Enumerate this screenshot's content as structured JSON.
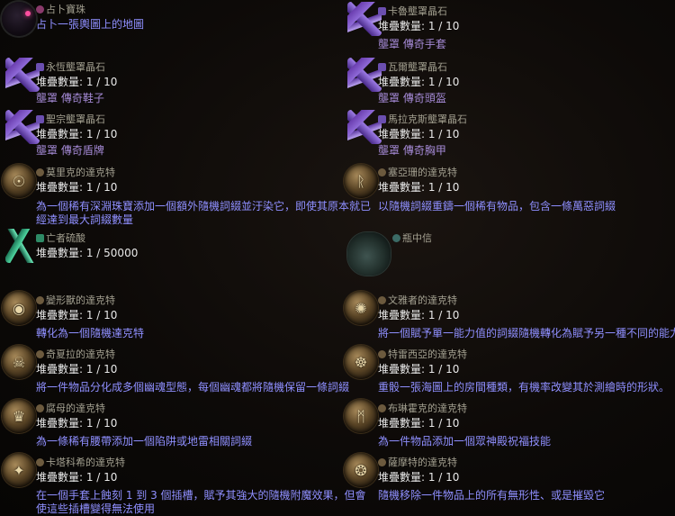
{
  "items": [
    {
      "name": "占卜寶珠",
      "stack": "",
      "desc": "占卜一張輿圖上的地圖",
      "veiled": "",
      "icon": "orb-icon"
    },
    {
      "name": "卡魯壟罩晶石",
      "stack": "堆疊數量: 1 / 10",
      "desc": "",
      "veiled": "壟罩 傳奇手套",
      "icon": "crystal-icon"
    },
    {
      "name": "永恆壟罩晶石",
      "stack": "堆疊數量: 1 / 10",
      "desc": "",
      "veiled": "壟罩 傳奇鞋子",
      "icon": "crystal-icon"
    },
    {
      "name": "瓦爾壟罩晶石",
      "stack": "堆疊數量: 1 / 10",
      "desc": "",
      "veiled": "壟罩 傳奇頭盔",
      "icon": "crystal-icon"
    },
    {
      "name": "聖宗壟罩晶石",
      "stack": "堆疊數量: 1 / 10",
      "desc": "",
      "veiled": "壟罩 傳奇盾牌",
      "icon": "crystal-icon"
    },
    {
      "name": "馬拉克斯壟罩晶石",
      "stack": "堆疊數量: 1 / 10",
      "desc": "",
      "veiled": "壟罩 傳奇胸甲",
      "icon": "crystal-icon"
    },
    {
      "name": "莫里克的達克特",
      "stack": "堆疊數量: 1 / 10",
      "desc": "為一個稀有深淵珠寶添加一個額外隨機詞綴並汙染它，即使其原本就已",
      "desc2": "經達到最大詞綴數量",
      "veiled": "",
      "icon": "ducat-icon"
    },
    {
      "name": "塞亞珊的達克特",
      "stack": "堆疊數量: 1 / 10",
      "desc": "以隨機詞綴重鑄一個稀有物品，包含一條萬惡詞綴",
      "veiled": "",
      "icon": "ducat-icon"
    },
    {
      "name": "亡者硫酸",
      "stack": "堆疊數量: 1 / 50000",
      "desc": "",
      "veiled": "",
      "icon": "acid-icon"
    },
    {
      "name": "瓶中信",
      "stack": "",
      "desc": "",
      "veiled": "",
      "icon": "bottle-icon"
    },
    {
      "name": "變形獸的達克特",
      "stack": "堆疊數量: 1 / 10",
      "desc": "轉化為一個隨機達克特",
      "veiled": "",
      "icon": "ducat-icon"
    },
    {
      "name": "文雅者的達克特",
      "stack": "堆疊數量: 1 / 10",
      "desc": "將一個賦予單一能力值的詞綴隨機轉化為賦予另一種不同的能力值",
      "veiled": "",
      "icon": "ducat-icon"
    },
    {
      "name": "奇夏拉的達克特",
      "stack": "堆疊數量: 1 / 10",
      "desc": "將一件物品分化成多個幽魂型態，每個幽魂都將隨機保留一條詞綴",
      "veiled": "",
      "icon": "ducat-icon"
    },
    {
      "name": "特雷西亞的達克特",
      "stack": "堆疊數量: 1 / 10",
      "desc": "重骰一張海圖上的房間種類，有機率改變其於測繪時的形狀。",
      "veiled": "",
      "icon": "ducat-icon"
    },
    {
      "name": "腐母的達克特",
      "stack": "堆疊數量: 1 / 10",
      "desc": "為一條稀有腰帶添加一個陷阱或地雷相關詞綴",
      "veiled": "",
      "icon": "ducat-icon"
    },
    {
      "name": "布琳霍克的達克特",
      "stack": "堆疊數量: 1 / 10",
      "desc": "為一件物品添加一個眾神殿祝福技能",
      "veiled": "",
      "icon": "ducat-icon"
    },
    {
      "name": "卡塔科希的達克特",
      "stack": "堆疊數量: 1 / 10",
      "desc": "在一個手套上蝕刻 1 到 3 個插槽，賦予其強大的隨機附魔效果，但會",
      "desc2": "使這些插槽變得無法使用",
      "veiled": "",
      "icon": "ducat-icon"
    },
    {
      "name": "薩摩特的達克特",
      "stack": "堆疊數量: 1 / 10",
      "desc": "隨機移除一件物品上的所有無形性、或是摧毀它",
      "veiled": "",
      "icon": "ducat-icon"
    }
  ]
}
